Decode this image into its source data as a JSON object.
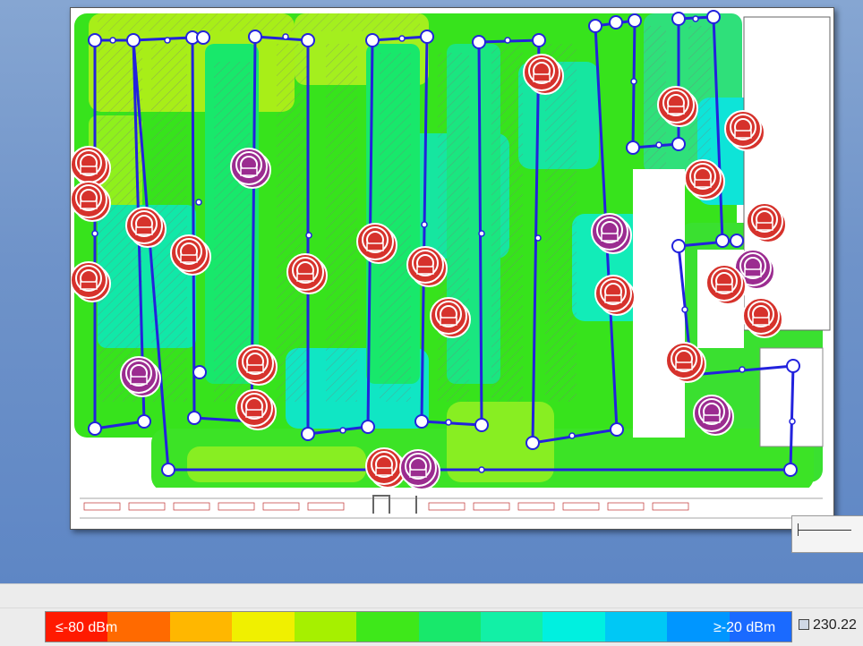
{
  "legend": {
    "min_label": "≤-80 dBm",
    "max_label": "≥-20 dBm",
    "colors": [
      "#ff1a00",
      "#ff6a00",
      "#ffb700",
      "#f0f000",
      "#a6f000",
      "#3ee81a",
      "#18e86b",
      "#12f0a6",
      "#00f0e0",
      "#00c8f5",
      "#0096ff",
      "#1a6aff"
    ]
  },
  "readout": {
    "value": "230.22"
  },
  "icons": {
    "area": "area-icon",
    "access_point": "access-point-icon"
  },
  "colors": {
    "route": "#2222dd",
    "ap_red": "#d6322c",
    "ap_purple": "#9b2c90"
  }
}
